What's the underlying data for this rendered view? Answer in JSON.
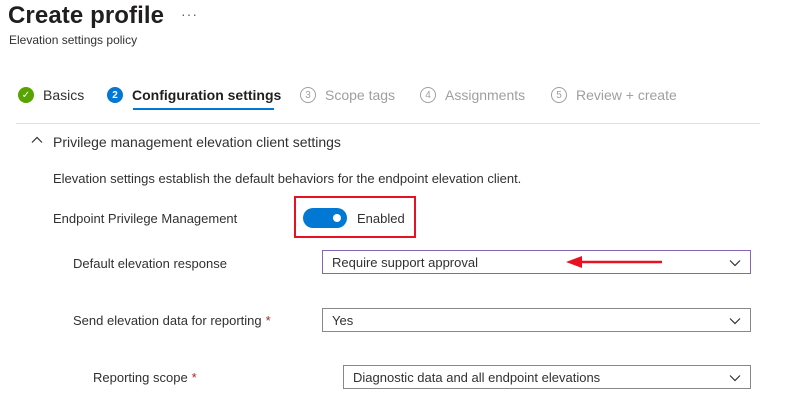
{
  "header": {
    "title": "Create profile",
    "more_label": "···",
    "subtitle": "Elevation settings policy"
  },
  "wizard": {
    "steps": [
      {
        "number": "✓",
        "label": "Basics",
        "state": "done"
      },
      {
        "number": "2",
        "label": "Configuration settings",
        "state": "active"
      },
      {
        "number": "3",
        "label": "Scope tags",
        "state": "inactive"
      },
      {
        "number": "4",
        "label": "Assignments",
        "state": "inactive"
      },
      {
        "number": "5",
        "label": "Review + create",
        "state": "inactive"
      }
    ]
  },
  "section": {
    "title": "Privilege management elevation client settings",
    "description": "Elevation settings establish the default behaviors for the endpoint elevation client."
  },
  "settings": {
    "epm": {
      "label": "Endpoint Privilege Management",
      "toggle_text": "Enabled",
      "enabled": true
    },
    "default_response": {
      "label": "Default elevation response",
      "value": "Require support approval"
    },
    "send_data": {
      "label": "Send elevation data for reporting",
      "required_mark": "*",
      "value": "Yes"
    },
    "reporting_scope": {
      "label": "Reporting scope",
      "required_mark": "*",
      "value": "Diagnostic data and all endpoint elevations"
    }
  },
  "colors": {
    "accent": "#0078d4",
    "success": "#57a300",
    "annotation": "#e81123",
    "focus_border": "#8764b8"
  },
  "icons": {
    "chevron_up": "chevron-up-icon",
    "chevron_down": "chevron-down-icon",
    "check": "checkmark-icon"
  }
}
